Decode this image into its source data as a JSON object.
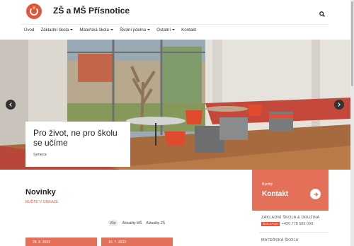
{
  "header": {
    "title": "ZŠ a MŠ Přísnotice",
    "logo_icon": "school-logo-icon",
    "search_icon": "search-icon"
  },
  "nav": {
    "items": [
      {
        "label": "Úvod",
        "dropdown": false
      },
      {
        "label": "Základní škola",
        "dropdown": true
      },
      {
        "label": "Mateřská škola",
        "dropdown": true
      },
      {
        "label": "Školní jídelna",
        "dropdown": true
      },
      {
        "label": "Ostatní",
        "dropdown": true
      },
      {
        "label": "Kontakt",
        "dropdown": false
      }
    ]
  },
  "hero": {
    "quote": "Pro život, ne pro školu se učíme",
    "author": "Seneca",
    "prev_icon": "chevron-left-icon",
    "next_icon": "chevron-right-icon"
  },
  "news": {
    "title": "Novinky",
    "subtitle": "BUĎTE V OBRAZE",
    "filters": [
      "Vše",
      "Aktuality MŠ",
      "Aktuality ZŠ"
    ],
    "active_filter": "Vše",
    "cards": [
      {
        "date": "28. 8. 2023"
      },
      {
        "date": "19. 7. 2023"
      }
    ]
  },
  "contact": {
    "small": "Rychlý",
    "big": "Kontakt",
    "arrow_icon": "arrow-right-icon",
    "school_name": "ZÁKLADNÍ ŠKOLA & DRUŽINA",
    "badge": "ŠKOLA PLUS",
    "phone": "+420 778 589 090",
    "kinder_name": "MATEŘSKÁ ŠKOLA"
  },
  "colors": {
    "accent": "#e5705a",
    "brand_red": "#e5533a",
    "text": "#222222"
  }
}
